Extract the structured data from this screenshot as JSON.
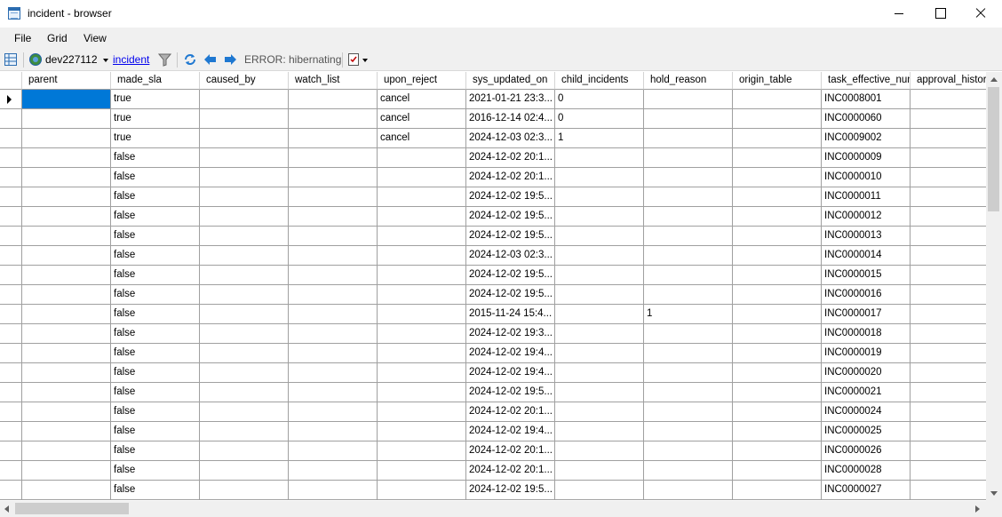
{
  "window": {
    "title": "incident - browser"
  },
  "menu": {
    "items": [
      "File",
      "Grid",
      "View"
    ]
  },
  "toolbar": {
    "instance": "dev227112",
    "table_link": "incident",
    "status": "ERROR: hibernating"
  },
  "grid": {
    "columns": [
      "parent",
      "made_sla",
      "caused_by",
      "watch_list",
      "upon_reject",
      "sys_updated_on",
      "child_incidents",
      "hold_reason",
      "origin_table",
      "task_effective_num",
      "approval_history"
    ],
    "rows": [
      [
        "",
        "true",
        "",
        "",
        "cancel",
        "2021-01-21 23:3...",
        "0",
        "",
        "",
        "INC0008001",
        ""
      ],
      [
        "",
        "true",
        "",
        "",
        "cancel",
        "2016-12-14 02:4...",
        "0",
        "",
        "",
        "INC0000060",
        ""
      ],
      [
        "",
        "true",
        "",
        "",
        "cancel",
        "2024-12-03 02:3...",
        "1",
        "",
        "",
        "INC0009002",
        ""
      ],
      [
        "",
        "false",
        "",
        "",
        "",
        "2024-12-02 20:1...",
        "",
        "",
        "",
        "INC0000009",
        ""
      ],
      [
        "",
        "false",
        "",
        "",
        "",
        "2024-12-02 20:1...",
        "",
        "",
        "",
        "INC0000010",
        ""
      ],
      [
        "",
        "false",
        "",
        "",
        "",
        "2024-12-02 19:5...",
        "",
        "",
        "",
        "INC0000011",
        ""
      ],
      [
        "",
        "false",
        "",
        "",
        "",
        "2024-12-02 19:5...",
        "",
        "",
        "",
        "INC0000012",
        ""
      ],
      [
        "",
        "false",
        "",
        "",
        "",
        "2024-12-02 19:5...",
        "",
        "",
        "",
        "INC0000013",
        ""
      ],
      [
        "",
        "false",
        "",
        "",
        "",
        "2024-12-03 02:3...",
        "",
        "",
        "",
        "INC0000014",
        ""
      ],
      [
        "",
        "false",
        "",
        "",
        "",
        "2024-12-02 19:5...",
        "",
        "",
        "",
        "INC0000015",
        ""
      ],
      [
        "",
        "false",
        "",
        "",
        "",
        "2024-12-02 19:5...",
        "",
        "",
        "",
        "INC0000016",
        ""
      ],
      [
        "",
        "false",
        "",
        "",
        "",
        "2015-11-24 15:4...",
        "",
        "1",
        "",
        "INC0000017",
        ""
      ],
      [
        "",
        "false",
        "",
        "",
        "",
        "2024-12-02 19:3...",
        "",
        "",
        "",
        "INC0000018",
        ""
      ],
      [
        "",
        "false",
        "",
        "",
        "",
        "2024-12-02 19:4...",
        "",
        "",
        "",
        "INC0000019",
        ""
      ],
      [
        "",
        "false",
        "",
        "",
        "",
        "2024-12-02 19:4...",
        "",
        "",
        "",
        "INC0000020",
        ""
      ],
      [
        "",
        "false",
        "",
        "",
        "",
        "2024-12-02 19:5...",
        "",
        "",
        "",
        "INC0000021",
        ""
      ],
      [
        "",
        "false",
        "",
        "",
        "",
        "2024-12-02 20:1...",
        "",
        "",
        "",
        "INC0000024",
        ""
      ],
      [
        "",
        "false",
        "",
        "",
        "",
        "2024-12-02 19:4...",
        "",
        "",
        "",
        "INC0000025",
        ""
      ],
      [
        "",
        "false",
        "",
        "",
        "",
        "2024-12-02 20:1...",
        "",
        "",
        "",
        "INC0000026",
        ""
      ],
      [
        "",
        "false",
        "",
        "",
        "",
        "2024-12-02 20:1...",
        "",
        "",
        "",
        "INC0000028",
        ""
      ],
      [
        "",
        "false",
        "",
        "",
        "",
        "2024-12-02 19:5...",
        "",
        "",
        "",
        "INC0000027",
        ""
      ]
    ]
  },
  "colors": {
    "selection": "#0078d7",
    "link": "#0000ee"
  }
}
